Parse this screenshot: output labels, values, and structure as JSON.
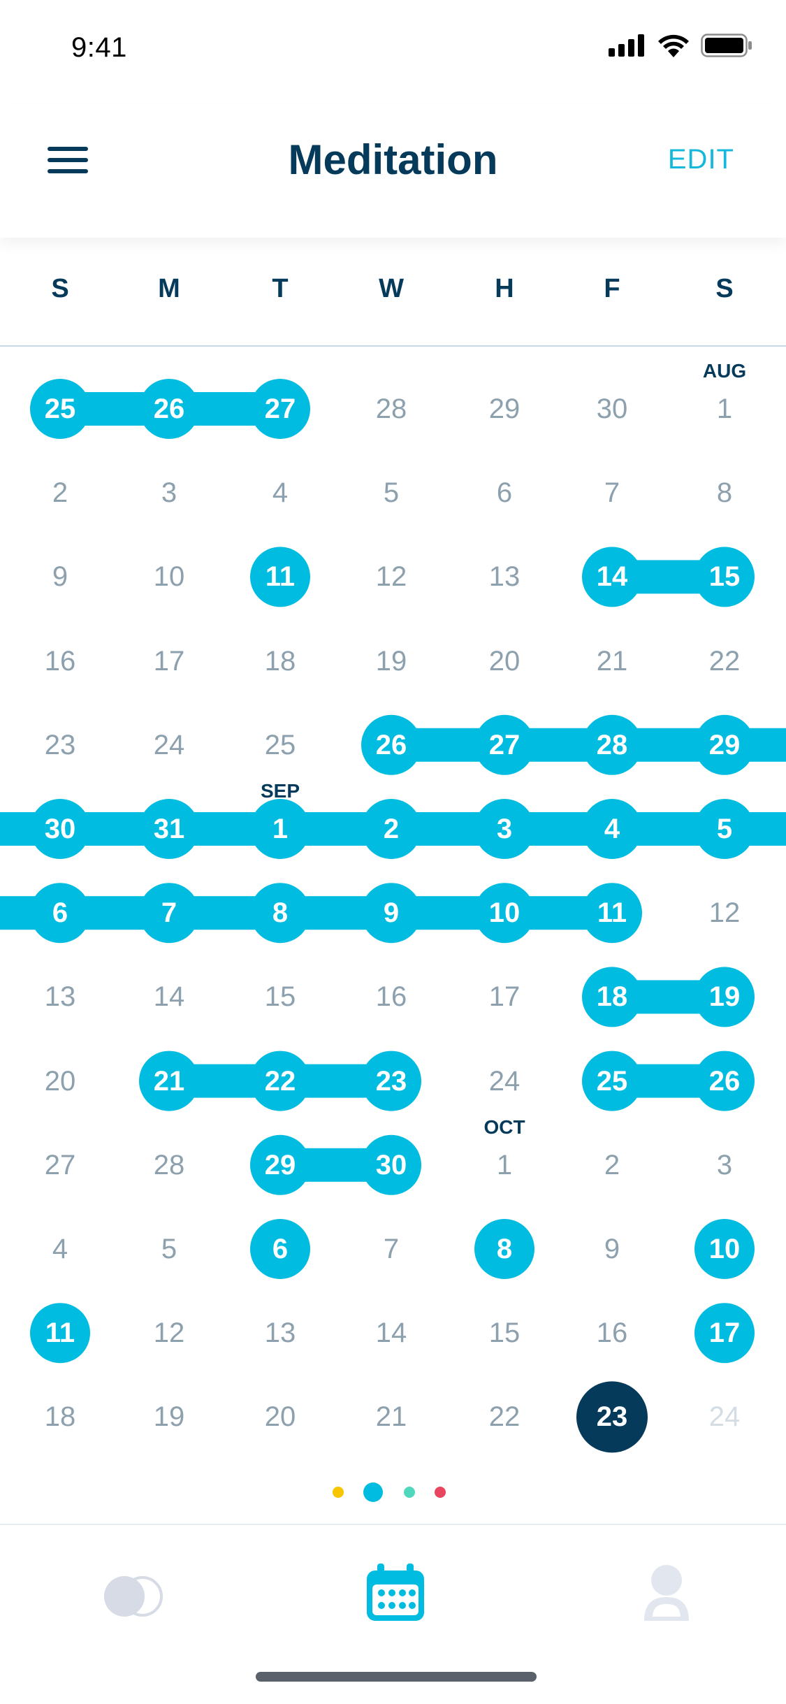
{
  "status_bar": {
    "time": "9:41"
  },
  "header": {
    "title": "Meditation",
    "edit_label": "EDIT",
    "menu_icon": "hamburger-menu-icon"
  },
  "weekdays": [
    "S",
    "M",
    "T",
    "W",
    "H",
    "F",
    "S"
  ],
  "colors": {
    "accent": "#00BCE0",
    "navy": "#063A5B",
    "muted": "#8DA0AD",
    "faded": "#D4DDE4"
  },
  "calendar": {
    "month_markers": [
      {
        "label": "AUG",
        "row": 0,
        "col": 6
      },
      {
        "label": "SEP",
        "row": 5,
        "col": 2
      },
      {
        "label": "OCT",
        "row": 9,
        "col": 4
      }
    ],
    "weeks": [
      [
        {
          "d": "25",
          "s": 1
        },
        {
          "d": "26",
          "s": 1
        },
        {
          "d": "27",
          "s": 1
        },
        {
          "d": "28"
        },
        {
          "d": "29"
        },
        {
          "d": "30"
        },
        {
          "d": "1"
        }
      ],
      [
        {
          "d": "2"
        },
        {
          "d": "3"
        },
        {
          "d": "4"
        },
        {
          "d": "5"
        },
        {
          "d": "6"
        },
        {
          "d": "7"
        },
        {
          "d": "8"
        }
      ],
      [
        {
          "d": "9"
        },
        {
          "d": "10"
        },
        {
          "d": "11",
          "s": 1
        },
        {
          "d": "12"
        },
        {
          "d": "13"
        },
        {
          "d": "14",
          "s": 1
        },
        {
          "d": "15",
          "s": 1
        }
      ],
      [
        {
          "d": "16"
        },
        {
          "d": "17"
        },
        {
          "d": "18"
        },
        {
          "d": "19"
        },
        {
          "d": "20"
        },
        {
          "d": "21"
        },
        {
          "d": "22"
        }
      ],
      [
        {
          "d": "23"
        },
        {
          "d": "24"
        },
        {
          "d": "25"
        },
        {
          "d": "26",
          "s": 1
        },
        {
          "d": "27",
          "s": 1
        },
        {
          "d": "28",
          "s": 1
        },
        {
          "d": "29",
          "s": 1
        }
      ],
      [
        {
          "d": "30",
          "s": 1
        },
        {
          "d": "31",
          "s": 1
        },
        {
          "d": "1",
          "s": 1
        },
        {
          "d": "2",
          "s": 1
        },
        {
          "d": "3",
          "s": 1
        },
        {
          "d": "4",
          "s": 1
        },
        {
          "d": "5",
          "s": 1
        }
      ],
      [
        {
          "d": "6",
          "s": 1
        },
        {
          "d": "7",
          "s": 1
        },
        {
          "d": "8",
          "s": 1
        },
        {
          "d": "9",
          "s": 1
        },
        {
          "d": "10",
          "s": 1
        },
        {
          "d": "11",
          "s": 1
        },
        {
          "d": "12"
        }
      ],
      [
        {
          "d": "13"
        },
        {
          "d": "14"
        },
        {
          "d": "15"
        },
        {
          "d": "16"
        },
        {
          "d": "17"
        },
        {
          "d": "18",
          "s": 1
        },
        {
          "d": "19",
          "s": 1
        }
      ],
      [
        {
          "d": "20"
        },
        {
          "d": "21",
          "s": 1
        },
        {
          "d": "22",
          "s": 1
        },
        {
          "d": "23",
          "s": 1
        },
        {
          "d": "24"
        },
        {
          "d": "25",
          "s": 1
        },
        {
          "d": "26",
          "s": 1
        }
      ],
      [
        {
          "d": "27"
        },
        {
          "d": "28"
        },
        {
          "d": "29",
          "s": 1
        },
        {
          "d": "30",
          "s": 1
        },
        {
          "d": "1"
        },
        {
          "d": "2"
        },
        {
          "d": "3"
        }
      ],
      [
        {
          "d": "4"
        },
        {
          "d": "5"
        },
        {
          "d": "6",
          "s": 1
        },
        {
          "d": "7"
        },
        {
          "d": "8",
          "s": 1
        },
        {
          "d": "9"
        },
        {
          "d": "10",
          "s": 1
        }
      ],
      [
        {
          "d": "11",
          "s": 1
        },
        {
          "d": "12"
        },
        {
          "d": "13"
        },
        {
          "d": "14"
        },
        {
          "d": "15"
        },
        {
          "d": "16"
        },
        {
          "d": "17",
          "s": 1
        }
      ],
      [
        {
          "d": "18"
        },
        {
          "d": "19"
        },
        {
          "d": "20"
        },
        {
          "d": "21"
        },
        {
          "d": "22"
        },
        {
          "d": "23",
          "today": 1
        },
        {
          "d": "24",
          "future": 1
        }
      ]
    ],
    "continues_left_rows": [
      5,
      6
    ],
    "continues_right_rows": [
      4,
      5
    ]
  },
  "pager": {
    "active_index": 1,
    "dots": [
      {
        "color": "#F7C600"
      },
      {
        "color": "#00BCE0"
      },
      {
        "color": "#4FD8BE"
      },
      {
        "color": "#E8455E"
      }
    ]
  },
  "tabbar": {
    "active": "calendar",
    "tabs": [
      {
        "name": "toggle-tab",
        "icon": "toggle-circles-icon"
      },
      {
        "name": "calendar-tab",
        "icon": "calendar-icon"
      },
      {
        "name": "profile-tab",
        "icon": "person-icon"
      }
    ]
  }
}
